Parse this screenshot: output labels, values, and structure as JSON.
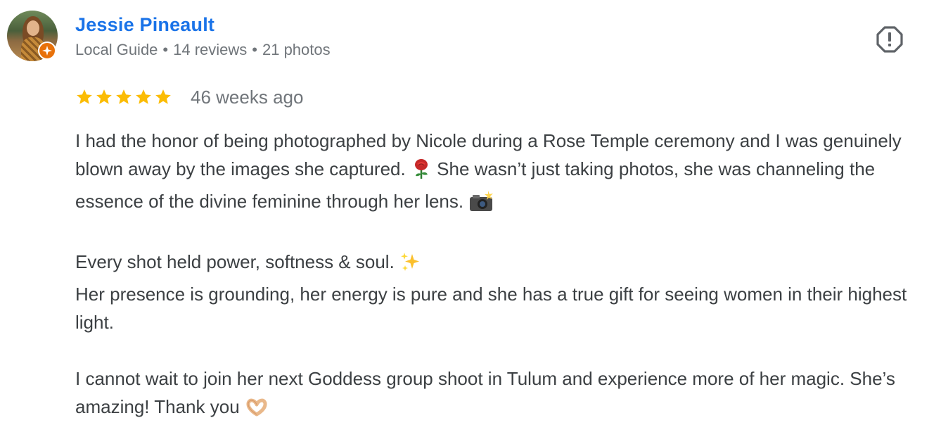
{
  "reviewer": {
    "name": "Jessie Pineault",
    "level": "Local Guide",
    "reviews": "14 reviews",
    "photos": "21 photos",
    "separator": "•"
  },
  "rating": {
    "stars": 5,
    "max_stars": 5,
    "date": "46 weeks ago",
    "star_color": "#fbbc04"
  },
  "review": {
    "paragraph1_a": "I had the honor of being photographed by Nicole during a Rose Temple ceremony and I was genuinely blown away by the images she captured. ",
    "paragraph1_b": " She wasn’t just taking photos, she was channeling the essence of the divine feminine through her lens. ",
    "paragraph2_line1": "Every shot held power, softness & soul. ",
    "paragraph2_line2": "Her presence is grounding, her energy is pure and she has a true gift for seeing women in their highest light.",
    "paragraph3": "I cannot wait to join her next Goddess group shoot in Tulum and experience more of her magic. She’s amazing! Thank you ",
    "emojis": [
      "rose-icon",
      "camera-flash-icon",
      "sparkles-icon",
      "heart-hands-icon"
    ]
  },
  "colors": {
    "name": "#1a73e8",
    "text": "#3c4043",
    "muted": "#70757a",
    "guide_badge": "#e8710a"
  },
  "icons": {
    "report": "report-flag-icon"
  }
}
